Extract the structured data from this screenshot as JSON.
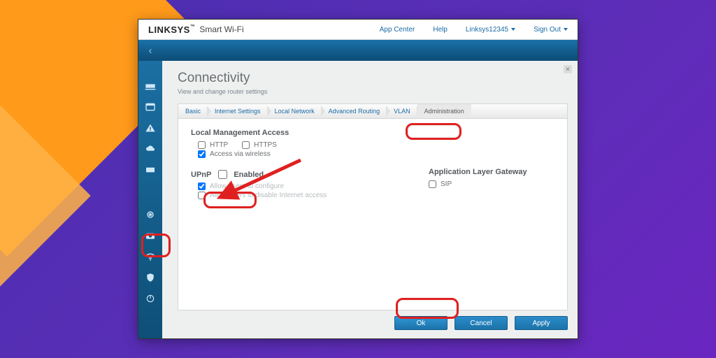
{
  "header": {
    "brand": "LINKSYS",
    "brand_sub": "Smart Wi-Fi",
    "nav": {
      "app_center": "App Center",
      "help": "Help",
      "account": "Linksys12345",
      "sign_out": "Sign Out"
    }
  },
  "page": {
    "title": "Connectivity",
    "subtitle": "View and change router settings"
  },
  "tabs": {
    "basic": "Basic",
    "internet": "Internet Settings",
    "local_net": "Local Network",
    "adv_routing": "Advanced Routing",
    "vlan": "VLAN",
    "admin": "Administration"
  },
  "lma": {
    "heading": "Local Management Access",
    "http": "HTTP",
    "https": "HTTPS",
    "wireless": "Access via wireless"
  },
  "upnp": {
    "heading": "UPnP",
    "enabled": "Enabled",
    "allow_config": "Allow users to configure",
    "allow_disable": "Allow users to disable Internet access"
  },
  "alg": {
    "heading": "Application Layer Gateway",
    "sip": "SIP"
  },
  "buttons": {
    "ok": "Ok",
    "cancel": "Cancel",
    "apply": "Apply"
  },
  "form_state": {
    "http_checked": false,
    "https_checked": false,
    "wireless_checked": true,
    "upnp_enabled": false,
    "allow_config_checked": true,
    "allow_disable_checked": false,
    "sip_checked": false
  }
}
